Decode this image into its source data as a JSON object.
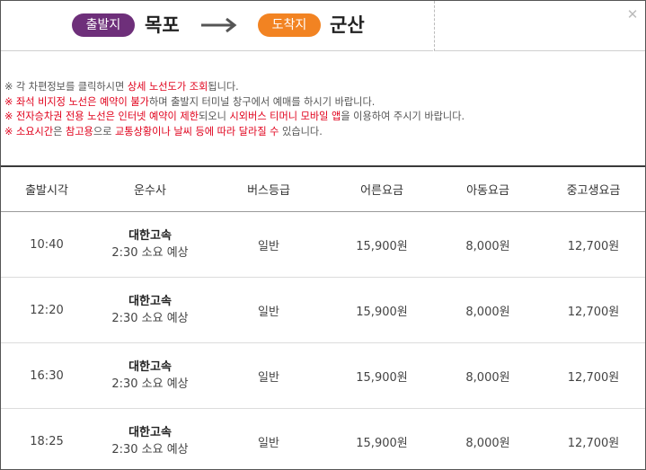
{
  "route": {
    "departure_badge": "출발지",
    "departure_city": "목포",
    "arrival_badge": "도착지",
    "arrival_city": "군산",
    "colors": {
      "departure_badge": "#6e2f7a",
      "arrival_badge": "#f28322",
      "highlight": "#e0001b"
    }
  },
  "notices": [
    [
      {
        "t": "※",
        "c": "n"
      },
      {
        "t": " 각 차편정보를 클릭하시면 ",
        "c": "n"
      },
      {
        "t": "상세 노선도가 조회",
        "c": "r"
      },
      {
        "t": "됩니다.",
        "c": "n"
      }
    ],
    [
      {
        "t": "※",
        "c": "r"
      },
      {
        "t": " ",
        "c": "n"
      },
      {
        "t": "좌석 비지정 노선은 예약이 불가",
        "c": "r"
      },
      {
        "t": "하며 출발지 터미널 창구에서 예매를 하시기 바랍니다.",
        "c": "n"
      }
    ],
    [
      {
        "t": "※",
        "c": "r"
      },
      {
        "t": " ",
        "c": "n"
      },
      {
        "t": "전자승차권 전용 노선은 인터넷 예약이 제한",
        "c": "r"
      },
      {
        "t": "되오니 ",
        "c": "n"
      },
      {
        "t": "시외버스 티머니 모바일 앱",
        "c": "r"
      },
      {
        "t": "을 이용하여 주시기 바랍니다.",
        "c": "n"
      }
    ],
    [
      {
        "t": "※",
        "c": "r"
      },
      {
        "t": " ",
        "c": "n"
      },
      {
        "t": "소요시간",
        "c": "r"
      },
      {
        "t": "은 ",
        "c": "n"
      },
      {
        "t": "참고용",
        "c": "r"
      },
      {
        "t": "으로 ",
        "c": "n"
      },
      {
        "t": "교통상황이나 날씨 등에 따라 달라질 수",
        "c": "r"
      },
      {
        "t": " 있습니다.",
        "c": "n"
      }
    ]
  ],
  "table": {
    "headers": [
      "출발시각",
      "운수사",
      "버스등급",
      "어른요금",
      "아동요금",
      "중고생요금"
    ],
    "rows": [
      {
        "time": "10:40",
        "company": "대한고속",
        "duration": "2:30 소요 예상",
        "grade": "일반",
        "adult": "15,900원",
        "child": "8,000원",
        "youth": "12,700원"
      },
      {
        "time": "12:20",
        "company": "대한고속",
        "duration": "2:30 소요 예상",
        "grade": "일반",
        "adult": "15,900원",
        "child": "8,000원",
        "youth": "12,700원"
      },
      {
        "time": "16:30",
        "company": "대한고속",
        "duration": "2:30 소요 예상",
        "grade": "일반",
        "adult": "15,900원",
        "child": "8,000원",
        "youth": "12,700원"
      },
      {
        "time": "18:25",
        "company": "대한고속",
        "duration": "2:30 소요 예상",
        "grade": "일반",
        "adult": "15,900원",
        "child": "8,000원",
        "youth": "12,700원"
      }
    ]
  }
}
